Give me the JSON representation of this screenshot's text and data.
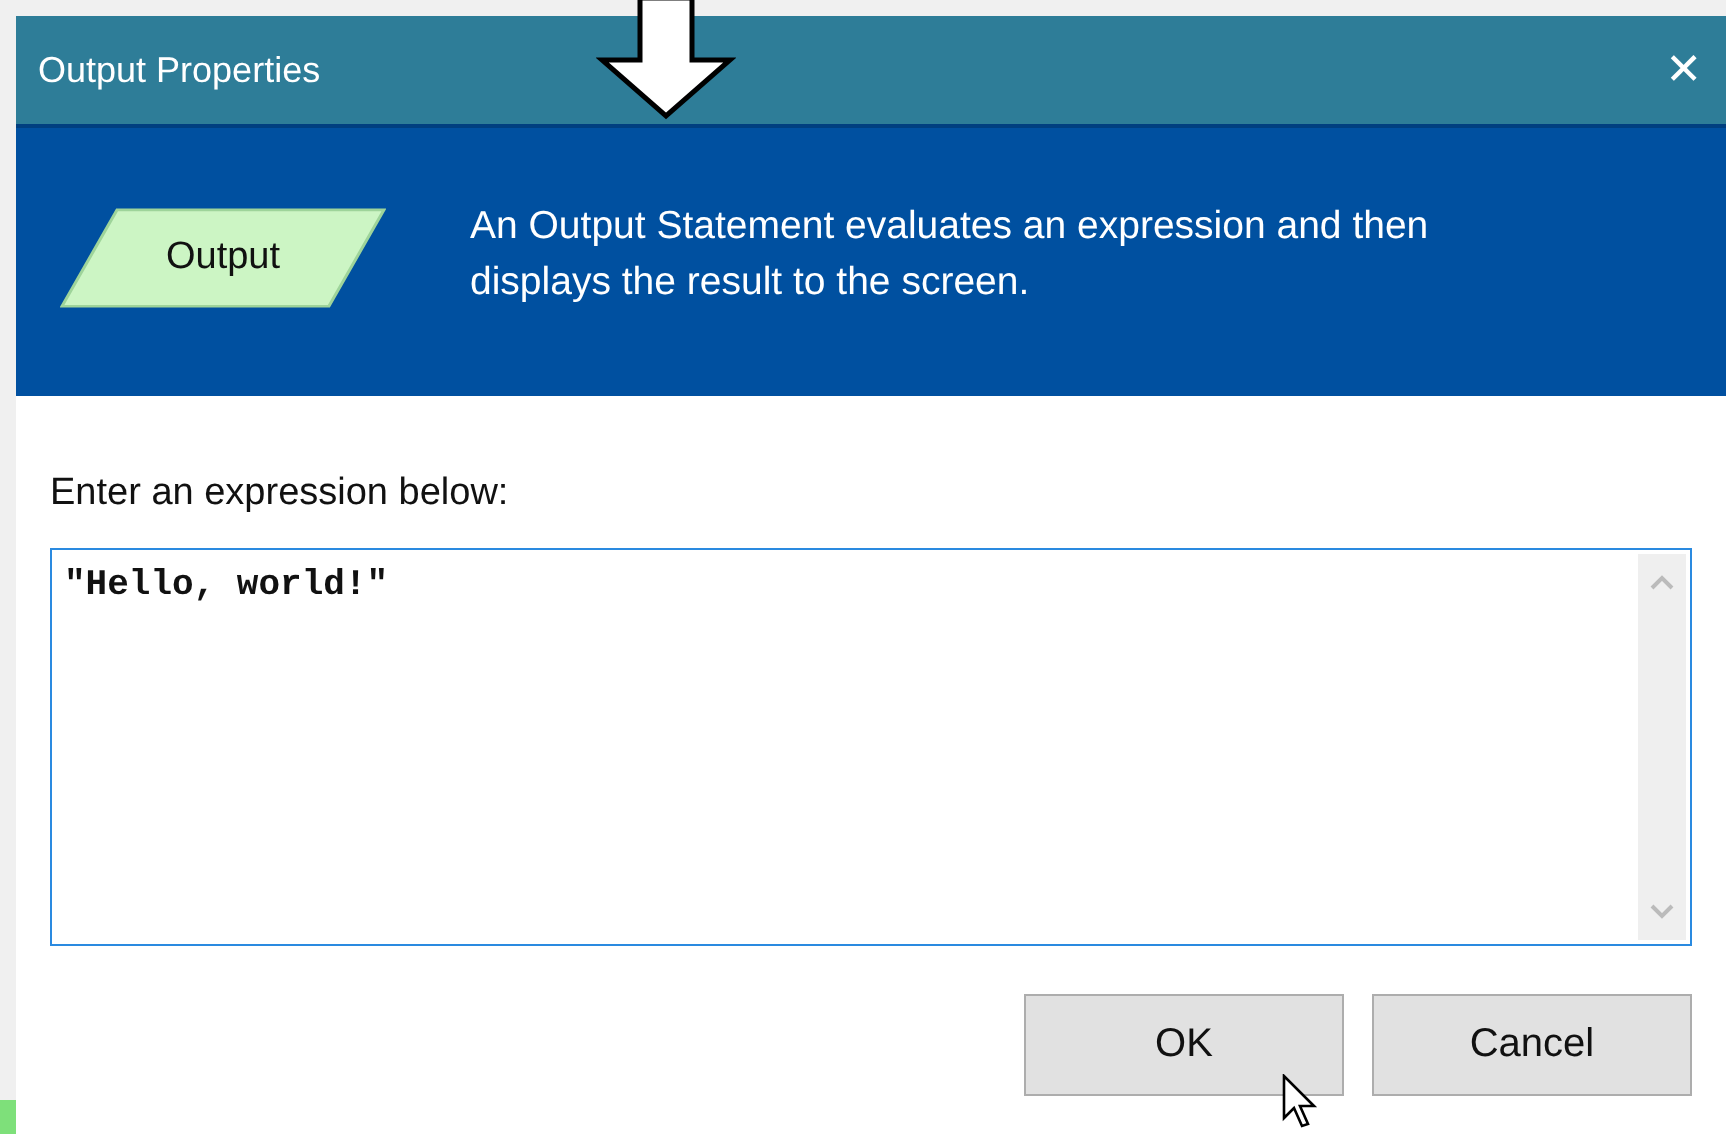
{
  "window": {
    "title": "Output Properties",
    "close": "✕"
  },
  "header": {
    "shape_label": "Output",
    "description": "An Output Statement evaluates an expression and then displays the result to the screen."
  },
  "prompt": "Enter an expression below:",
  "expression": {
    "value": "\"Hello, world!\""
  },
  "buttons": [
    {
      "label": "OK"
    },
    {
      "label": "Cancel"
    }
  ]
}
